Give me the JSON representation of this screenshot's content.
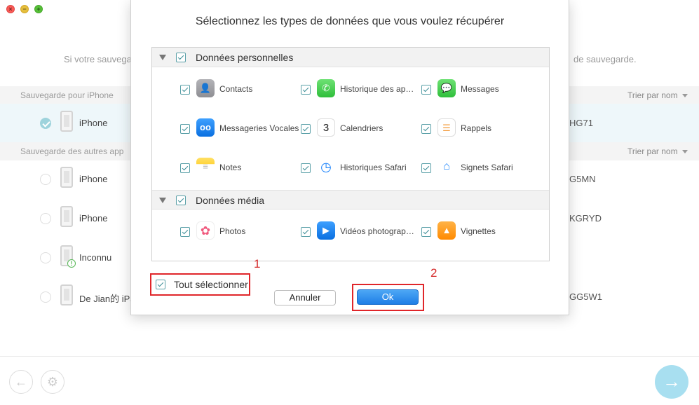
{
  "window": {
    "close_glyph": "×",
    "min_glyph": "−",
    "zoom_glyph": "+"
  },
  "background": {
    "hint_left": "Si votre sauvega",
    "hint_right": "de sauvegarde.",
    "section_iphone": "Sauvegarde pour iPhone",
    "section_other": "Sauvegarde des autres app",
    "sort_label": "Trier par nom",
    "devices": [
      {
        "name": "iPhone",
        "serial": "HG71",
        "selected": true
      },
      {
        "name": "iPhone",
        "serial": "G5MN",
        "selected": false
      },
      {
        "name": "iPhone",
        "serial": "KGRYD",
        "selected": false
      },
      {
        "name": "Inconnu",
        "serial": "",
        "selected": false
      },
      {
        "name": "De Jian的 iPa",
        "serial": "GG5W1",
        "selected": false
      }
    ],
    "warn_glyph": "!",
    "back_icon": "arrow-left-icon",
    "back_glyph": "←",
    "settings_icon": "gear-icon",
    "settings_glyph": "⚙",
    "next_icon": "arrow-right-icon",
    "next_glyph": "→",
    "accent": "#a8dff0"
  },
  "dialog": {
    "title": "Sélectionnez les types de données que vous voulez récupérer",
    "categories": [
      {
        "label": "Données personnelles",
        "items": [
          {
            "label": "Contacts",
            "icon": "contacts-icon",
            "glyph": "👤",
            "color": "#8e8e93"
          },
          {
            "label": "Historique des ap…",
            "icon": "phone-icon",
            "glyph": "✆",
            "color": "#4cd964"
          },
          {
            "label": "Messages",
            "icon": "messages-icon",
            "glyph": "💬",
            "color": "#4cd964"
          },
          {
            "label": "Messageries Vocales",
            "icon": "voicemail-icon",
            "glyph": "oo",
            "color": "#1a82fb"
          },
          {
            "label": "Calendriers",
            "icon": "calendar-icon",
            "glyph": "3",
            "color": "#ffffff"
          },
          {
            "label": "Rappels",
            "icon": "reminders-icon",
            "glyph": "☰",
            "color": "#ffffff"
          },
          {
            "label": "Notes",
            "icon": "notes-icon",
            "glyph": "≡",
            "color": "#ffd43b"
          },
          {
            "label": "Historiques Safari",
            "icon": "safari-history-icon",
            "glyph": "◷",
            "color": "#1a82fb"
          },
          {
            "label": "Signets Safari",
            "icon": "safari-bookmarks-icon",
            "glyph": "⌂",
            "color": "#1a82fb"
          }
        ]
      },
      {
        "label": "Données média",
        "items": [
          {
            "label": "Photos",
            "icon": "photos-icon",
            "glyph": "✿",
            "color": "#ffffff"
          },
          {
            "label": "Vidéos photograp…",
            "icon": "videos-icon",
            "glyph": "▶",
            "color": "#1a82fb"
          },
          {
            "label": "Vignettes",
            "icon": "thumbnails-icon",
            "glyph": "▲",
            "color": "#ff9500"
          }
        ]
      }
    ],
    "select_all": "Tout sélectionner",
    "cancel": "Annuler",
    "ok": "Ok",
    "annotation_1": "1",
    "annotation_2": "2"
  }
}
